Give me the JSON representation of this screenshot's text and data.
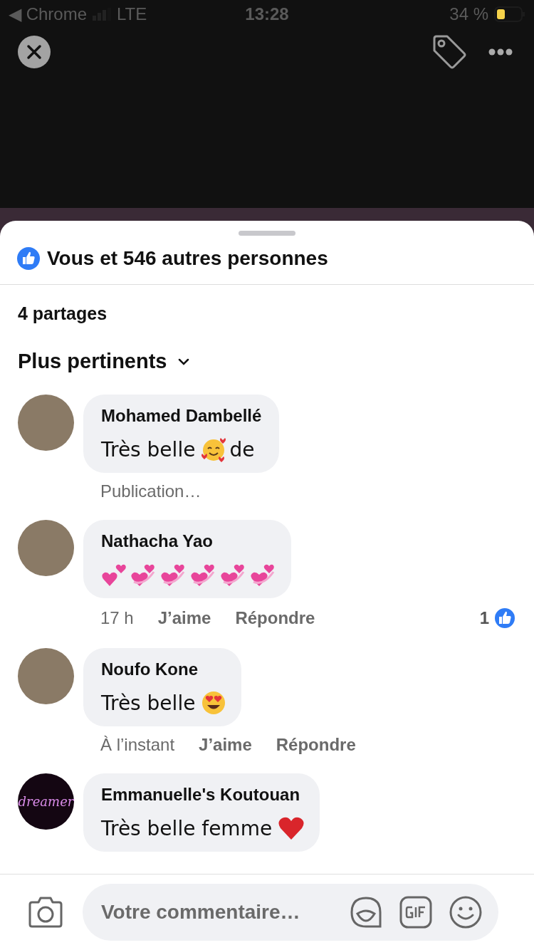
{
  "status_bar": {
    "back_app": "◀ Chrome",
    "network": "LTE",
    "time": "13:28",
    "battery": "34 %"
  },
  "reactions": {
    "summary": "Vous et 546 autres personnes"
  },
  "shares": "4 partages",
  "sort": {
    "label": "Plus pertinents"
  },
  "comments": [
    {
      "author": "Mohamed Dambellé",
      "parts": [
        {
          "kind": "text",
          "text": "Très belle"
        },
        {
          "kind": "face-hearts"
        },
        {
          "kind": "text",
          "text": "de"
        }
      ],
      "meta": [
        {
          "kind": "info",
          "text": "Publication…"
        }
      ]
    },
    {
      "author": "Nathacha Yao",
      "parts": [
        {
          "kind": "two-hearts"
        },
        {
          "kind": "revolving-hearts"
        },
        {
          "kind": "revolving-hearts"
        },
        {
          "kind": "revolving-hearts"
        },
        {
          "kind": "revolving-hearts"
        },
        {
          "kind": "revolving-hearts"
        }
      ],
      "meta": [
        {
          "kind": "info",
          "text": "17 h"
        },
        {
          "kind": "action",
          "text": "J’aime"
        },
        {
          "kind": "action",
          "text": "Répondre"
        }
      ],
      "like_count": "1"
    },
    {
      "author": "Noufo Kone",
      "parts": [
        {
          "kind": "text",
          "text": "Très belle"
        },
        {
          "kind": "heart-eyes"
        }
      ],
      "meta": [
        {
          "kind": "info",
          "text": "À l’instant"
        },
        {
          "kind": "action",
          "text": "J’aime"
        },
        {
          "kind": "action",
          "text": "Répondre"
        }
      ]
    },
    {
      "author": "Emmanuelle's Koutouan",
      "avatar_text": "dreamer",
      "parts": [
        {
          "kind": "text",
          "text": "Très belle femme"
        },
        {
          "kind": "red-heart"
        }
      ]
    }
  ],
  "composer": {
    "placeholder": "Votre commentaire…"
  }
}
